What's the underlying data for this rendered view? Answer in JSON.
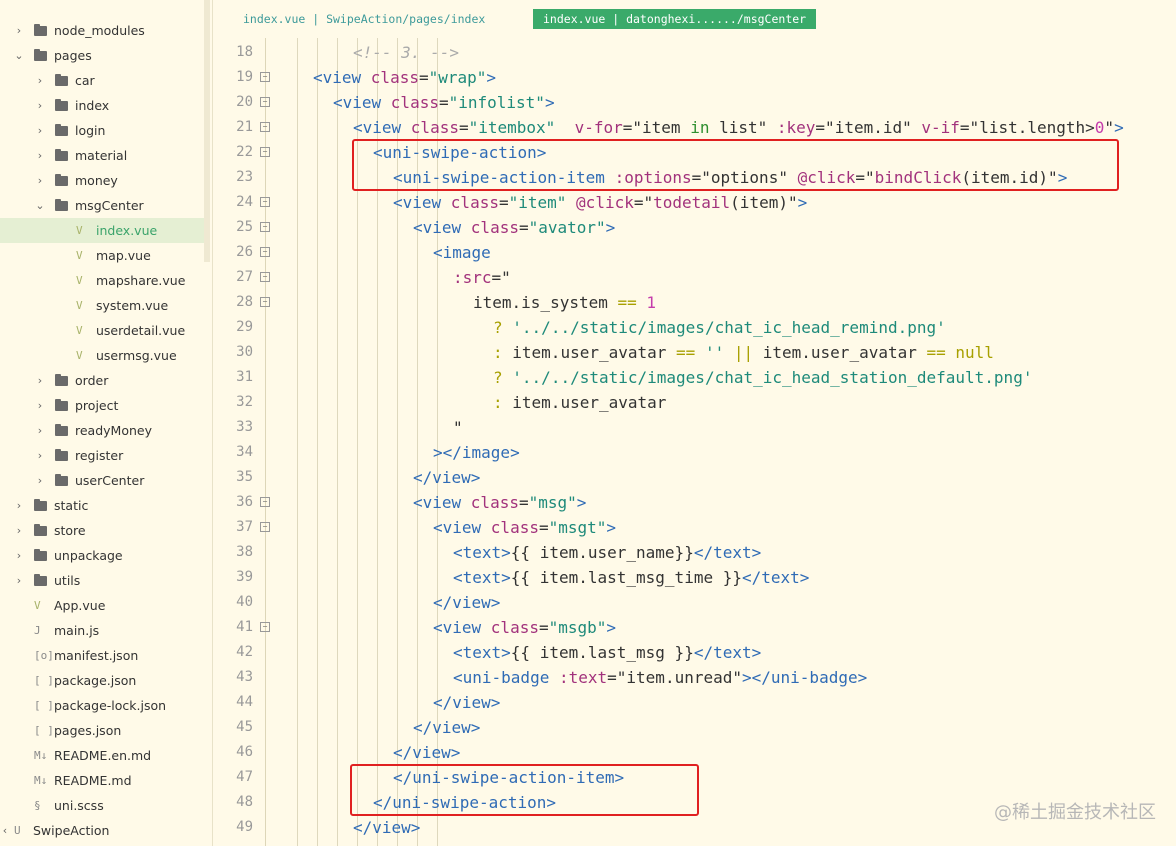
{
  "tabs": [
    {
      "label": "index.vue | SwipeAction/pages/index"
    },
    {
      "label": "index.vue | datonghexi....../msgCenter"
    }
  ],
  "tree": [
    {
      "label": "node_modules",
      "kind": "folder",
      "depth": 0,
      "expanded": false
    },
    {
      "label": "pages",
      "kind": "folder",
      "depth": 0,
      "expanded": true
    },
    {
      "label": "car",
      "kind": "folder",
      "depth": 1,
      "expanded": false
    },
    {
      "label": "index",
      "kind": "folder",
      "depth": 1,
      "expanded": false
    },
    {
      "label": "login",
      "kind": "folder",
      "depth": 1,
      "expanded": false
    },
    {
      "label": "material",
      "kind": "folder",
      "depth": 1,
      "expanded": false
    },
    {
      "label": "money",
      "kind": "folder",
      "depth": 1,
      "expanded": false
    },
    {
      "label": "msgCenter",
      "kind": "folder",
      "depth": 1,
      "expanded": true
    },
    {
      "label": "index.vue",
      "kind": "vue",
      "depth": 2,
      "selected": true
    },
    {
      "label": "map.vue",
      "kind": "vue",
      "depth": 2
    },
    {
      "label": "mapshare.vue",
      "kind": "vue",
      "depth": 2
    },
    {
      "label": "system.vue",
      "kind": "vue",
      "depth": 2
    },
    {
      "label": "userdetail.vue",
      "kind": "vue",
      "depth": 2
    },
    {
      "label": "usermsg.vue",
      "kind": "vue",
      "depth": 2
    },
    {
      "label": "order",
      "kind": "folder",
      "depth": 1,
      "expanded": false
    },
    {
      "label": "project",
      "kind": "folder",
      "depth": 1,
      "expanded": false
    },
    {
      "label": "readyMoney",
      "kind": "folder",
      "depth": 1,
      "expanded": false
    },
    {
      "label": "register",
      "kind": "folder",
      "depth": 1,
      "expanded": false
    },
    {
      "label": "userCenter",
      "kind": "folder",
      "depth": 1,
      "expanded": false
    },
    {
      "label": "static",
      "kind": "folder",
      "depth": 0,
      "expanded": false
    },
    {
      "label": "store",
      "kind": "folder",
      "depth": 0,
      "expanded": false
    },
    {
      "label": "unpackage",
      "kind": "folder",
      "depth": 0,
      "expanded": false
    },
    {
      "label": "utils",
      "kind": "folder",
      "depth": 0,
      "expanded": false
    },
    {
      "label": "App.vue",
      "kind": "vue",
      "depth": 0
    },
    {
      "label": "main.js",
      "kind": "js",
      "depth": 0
    },
    {
      "label": "manifest.json",
      "kind": "manifest",
      "depth": 0
    },
    {
      "label": "package.json",
      "kind": "json",
      "depth": 0
    },
    {
      "label": "package-lock.json",
      "kind": "json",
      "depth": 0
    },
    {
      "label": "pages.json",
      "kind": "json",
      "depth": 0
    },
    {
      "label": "README.en.md",
      "kind": "md",
      "depth": 0
    },
    {
      "label": "README.md",
      "kind": "md",
      "depth": 0
    },
    {
      "label": "uni.scss",
      "kind": "scss",
      "depth": 0
    },
    {
      "label": "SwipeAction",
      "kind": "project",
      "depth": -1
    }
  ],
  "code_lines": [
    {
      "n": "18",
      "fold": false,
      "indent": 2,
      "tokens": [
        [
          "c",
          "<!-- 3. -->"
        ]
      ]
    },
    {
      "n": "19",
      "fold": true,
      "indent": 0,
      "tokens": [
        [
          "t",
          "<view "
        ],
        [
          "a",
          "class"
        ],
        [
          "o",
          "="
        ],
        [
          "s",
          "\"wrap\""
        ],
        [
          "t",
          ">"
        ]
      ]
    },
    {
      "n": "20",
      "fold": true,
      "indent": 1,
      "tokens": [
        [
          "t",
          "<view "
        ],
        [
          "a",
          "class"
        ],
        [
          "o",
          "="
        ],
        [
          "s",
          "\"infolist\""
        ],
        [
          "t",
          ">"
        ]
      ]
    },
    {
      "n": "21",
      "fold": true,
      "indent": 2,
      "tokens": [
        [
          "t",
          "<view "
        ],
        [
          "a",
          "class"
        ],
        [
          "o",
          "="
        ],
        [
          "s",
          "\"itembox\""
        ],
        [
          "o",
          "  "
        ],
        [
          "a",
          "v-for"
        ],
        [
          "o",
          "=\"item "
        ],
        [
          "k",
          "in"
        ],
        [
          "o",
          " list\" "
        ],
        [
          "a",
          ":key"
        ],
        [
          "o",
          "=\"item.id\" "
        ],
        [
          "a",
          "v-if"
        ],
        [
          "o",
          "=\"list.length>"
        ],
        [
          "n",
          "0"
        ],
        [
          "o",
          "\""
        ],
        [
          "t",
          ">"
        ]
      ]
    },
    {
      "n": "22",
      "fold": true,
      "indent": 3,
      "tokens": [
        [
          "t",
          "<uni-swipe-action>"
        ]
      ]
    },
    {
      "n": "23",
      "fold": false,
      "indent": 4,
      "tokens": [
        [
          "t",
          "<uni-swipe-action-item "
        ],
        [
          "a",
          ":options"
        ],
        [
          "o",
          "=\"options\" "
        ],
        [
          "a",
          "@click"
        ],
        [
          "o",
          "=\""
        ],
        [
          "a",
          "bindClick"
        ],
        [
          "o",
          "(item.id)\""
        ],
        [
          "t",
          ">"
        ]
      ]
    },
    {
      "n": "24",
      "fold": true,
      "indent": 4,
      "tokens": [
        [
          "t",
          "<view "
        ],
        [
          "a",
          "class"
        ],
        [
          "o",
          "="
        ],
        [
          "s",
          "\"item\""
        ],
        [
          "o",
          " "
        ],
        [
          "a",
          "@click"
        ],
        [
          "o",
          "=\""
        ],
        [
          "a",
          "todetail"
        ],
        [
          "o",
          "(item)\""
        ],
        [
          "t",
          ">"
        ]
      ]
    },
    {
      "n": "25",
      "fold": true,
      "indent": 5,
      "tokens": [
        [
          "t",
          "<view "
        ],
        [
          "a",
          "class"
        ],
        [
          "o",
          "="
        ],
        [
          "s",
          "\"avator\""
        ],
        [
          "t",
          ">"
        ]
      ]
    },
    {
      "n": "26",
      "fold": true,
      "indent": 6,
      "tokens": [
        [
          "t",
          "<image"
        ]
      ]
    },
    {
      "n": "27",
      "fold": true,
      "indent": 7,
      "tokens": [
        [
          "a",
          ":src"
        ],
        [
          "o",
          "=\""
        ]
      ]
    },
    {
      "n": "28",
      "fold": true,
      "indent": 8,
      "tokens": [
        [
          "o",
          "item.is_system "
        ],
        [
          "y",
          "=="
        ],
        [
          "o",
          " "
        ],
        [
          "n",
          "1"
        ]
      ]
    },
    {
      "n": "29",
      "fold": false,
      "indent": 9,
      "tokens": [
        [
          "y",
          "?"
        ],
        [
          "o",
          " "
        ],
        [
          "s",
          "'../../static/images/chat_ic_head_remind.png'"
        ]
      ]
    },
    {
      "n": "30",
      "fold": false,
      "indent": 9,
      "tokens": [
        [
          "y",
          ":"
        ],
        [
          "o",
          " item.user_avatar "
        ],
        [
          "y",
          "=="
        ],
        [
          "o",
          " "
        ],
        [
          "s",
          "''"
        ],
        [
          "o",
          " "
        ],
        [
          "y",
          "||"
        ],
        [
          "o",
          " item.user_avatar "
        ],
        [
          "y",
          "=="
        ],
        [
          "o",
          " "
        ],
        [
          "y",
          "null"
        ]
      ]
    },
    {
      "n": "31",
      "fold": false,
      "indent": 9,
      "tokens": [
        [
          "y",
          "?"
        ],
        [
          "o",
          " "
        ],
        [
          "s",
          "'../../static/images/chat_ic_head_station_default.png'"
        ]
      ]
    },
    {
      "n": "32",
      "fold": false,
      "indent": 9,
      "tokens": [
        [
          "y",
          ":"
        ],
        [
          "o",
          " item.user_avatar"
        ]
      ]
    },
    {
      "n": "33",
      "fold": false,
      "indent": 7,
      "tokens": [
        [
          "o",
          "\""
        ]
      ]
    },
    {
      "n": "34",
      "fold": false,
      "indent": 6,
      "tokens": [
        [
          "t",
          "></image>"
        ]
      ]
    },
    {
      "n": "35",
      "fold": false,
      "indent": 5,
      "tokens": [
        [
          "t",
          "</view>"
        ]
      ]
    },
    {
      "n": "36",
      "fold": true,
      "indent": 5,
      "tokens": [
        [
          "t",
          "<view "
        ],
        [
          "a",
          "class"
        ],
        [
          "o",
          "="
        ],
        [
          "s",
          "\"msg\""
        ],
        [
          "t",
          ">"
        ]
      ]
    },
    {
      "n": "37",
      "fold": true,
      "indent": 6,
      "tokens": [
        [
          "t",
          "<view "
        ],
        [
          "a",
          "class"
        ],
        [
          "o",
          "="
        ],
        [
          "s",
          "\"msgt\""
        ],
        [
          "t",
          ">"
        ]
      ]
    },
    {
      "n": "38",
      "fold": false,
      "indent": 7,
      "tokens": [
        [
          "t",
          "<text>"
        ],
        [
          "o",
          "{{ item.user_name}}"
        ],
        [
          "t",
          "</text>"
        ]
      ]
    },
    {
      "n": "39",
      "fold": false,
      "indent": 7,
      "tokens": [
        [
          "t",
          "<text>"
        ],
        [
          "o",
          "{{ item.last_msg_time }}"
        ],
        [
          "t",
          "</text>"
        ]
      ]
    },
    {
      "n": "40",
      "fold": false,
      "indent": 6,
      "tokens": [
        [
          "t",
          "</view>"
        ]
      ]
    },
    {
      "n": "41",
      "fold": true,
      "indent": 6,
      "tokens": [
        [
          "t",
          "<view "
        ],
        [
          "a",
          "class"
        ],
        [
          "o",
          "="
        ],
        [
          "s",
          "\"msgb\""
        ],
        [
          "t",
          ">"
        ]
      ]
    },
    {
      "n": "42",
      "fold": false,
      "indent": 7,
      "tokens": [
        [
          "t",
          "<text>"
        ],
        [
          "o",
          "{{ item.last_msg }}"
        ],
        [
          "t",
          "</text>"
        ]
      ]
    },
    {
      "n": "43",
      "fold": false,
      "indent": 7,
      "tokens": [
        [
          "t",
          "<uni-badge "
        ],
        [
          "a",
          ":text"
        ],
        [
          "o",
          "=\"item.unread\""
        ],
        [
          "t",
          "></uni-badge>"
        ]
      ]
    },
    {
      "n": "44",
      "fold": false,
      "indent": 6,
      "tokens": [
        [
          "t",
          "</view>"
        ]
      ]
    },
    {
      "n": "45",
      "fold": false,
      "indent": 5,
      "tokens": [
        [
          "t",
          "</view>"
        ]
      ]
    },
    {
      "n": "46",
      "fold": false,
      "indent": 4,
      "tokens": [
        [
          "t",
          "</view>"
        ]
      ]
    },
    {
      "n": "47",
      "fold": false,
      "indent": 4,
      "tokens": [
        [
          "t",
          "</uni-swipe-action-item>"
        ]
      ]
    },
    {
      "n": "48",
      "fold": false,
      "indent": 3,
      "tokens": [
        [
          "t",
          "</uni-swipe-action>"
        ]
      ]
    },
    {
      "n": "49",
      "fold": false,
      "indent": 2,
      "tokens": [
        [
          "t",
          "</view>"
        ]
      ]
    }
  ],
  "watermark": "@稀土掘金技术社区"
}
